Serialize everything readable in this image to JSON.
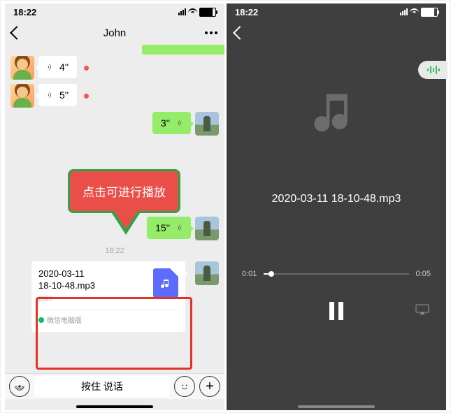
{
  "status": {
    "time": "18:22"
  },
  "chat": {
    "title": "John",
    "voices": {
      "in1": "4''",
      "in2": "5''",
      "out1": "3''",
      "out2": "15''"
    },
    "timestamp": "18:22",
    "file": {
      "name_l1": "2020-03-11",
      "name_l2": "18-10-48.mp3",
      "size": "89K",
      "source": "微信电脑版"
    },
    "input_placeholder": "按住 说话"
  },
  "tooltip": "点击可进行播放",
  "player": {
    "filename": "2020-03-11 18-10-48.mp3",
    "elapsed": "0:01",
    "total": "0:05"
  }
}
